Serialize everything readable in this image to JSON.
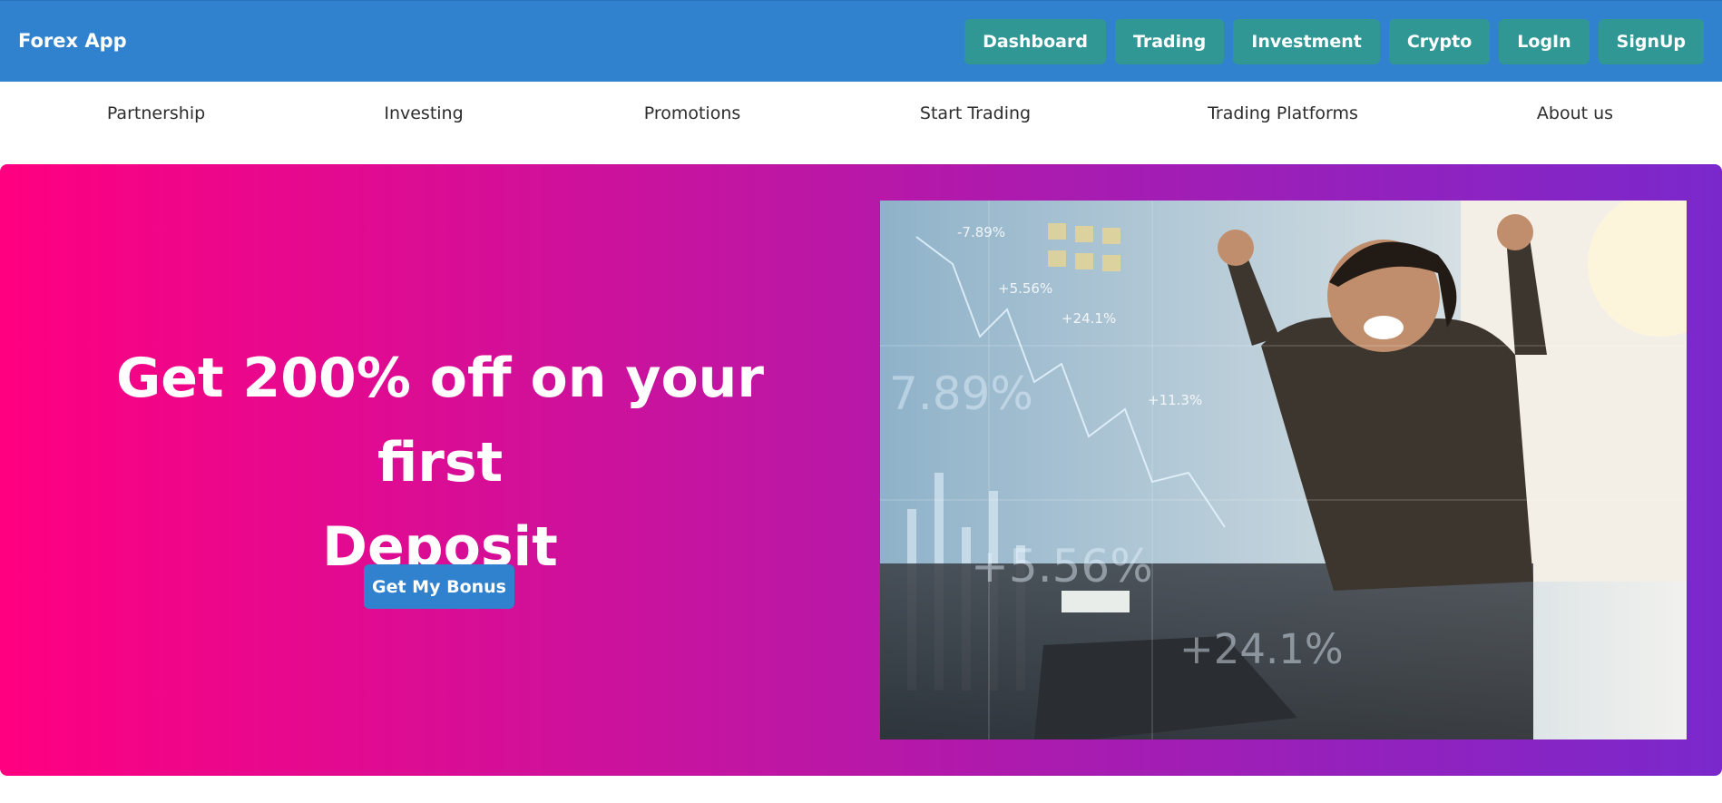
{
  "header": {
    "brand": "Forex App",
    "nav": [
      {
        "label": "Dashboard"
      },
      {
        "label": "Trading"
      },
      {
        "label": "Investment"
      },
      {
        "label": "Crypto"
      },
      {
        "label": "LogIn"
      },
      {
        "label": "SignUp"
      }
    ]
  },
  "subnav": {
    "items": [
      {
        "label": "Partnership"
      },
      {
        "label": "Investing"
      },
      {
        "label": "Promotions"
      },
      {
        "label": "Start Trading"
      },
      {
        "label": "Trading Platforms"
      },
      {
        "label": "About us"
      }
    ]
  },
  "hero": {
    "headline_line1": "Get 200% off on your first",
    "headline_line2": "Deposit",
    "cta": "Get My Bonus",
    "photo_overlay_values": [
      "-7.89%",
      "+5.56%",
      "+24.1%",
      "+11.3%",
      "7.89%",
      "+5.56%",
      "+24.1%"
    ]
  },
  "colors": {
    "header_bg": "#3182ce",
    "nav_button_bg": "#319795",
    "hero_gradient_start": "#ff0080",
    "hero_gradient_end": "#7a28cc",
    "cta_bg": "#3182ce"
  }
}
